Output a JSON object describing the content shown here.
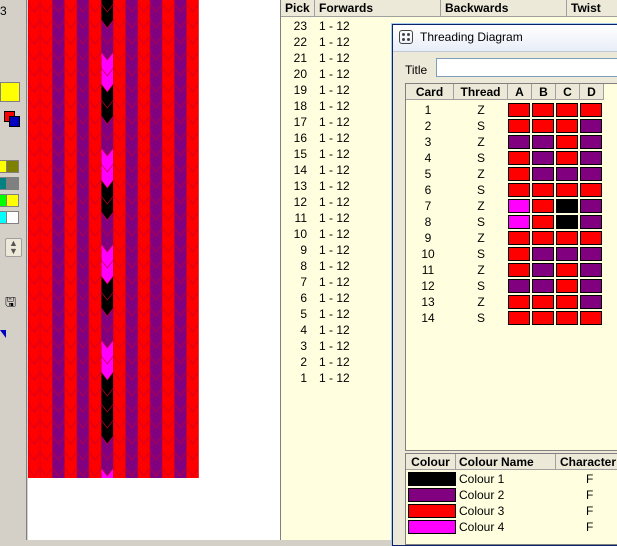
{
  "left_panel": {
    "top_text": "3",
    "swatches": [
      {
        "name": "swatch-yellow",
        "color": "#ffff00"
      },
      {
        "name": "swatch-olive",
        "color": "#808000"
      },
      {
        "name": "swatch-teal",
        "color": "#008080"
      },
      {
        "name": "swatch-gray",
        "color": "#808080"
      },
      {
        "name": "swatch-lime",
        "color": "#00ff00"
      },
      {
        "name": "swatch-yellow-2",
        "color": "#ffff00"
      },
      {
        "name": "swatch-cyan",
        "color": "#00ffff"
      },
      {
        "name": "swatch-white",
        "color": "#ffffff"
      }
    ]
  },
  "pattern": {
    "columns": [
      "#ff0000",
      "#ff0000",
      "#800080",
      "#ff0000",
      "#800080",
      "#ff0000",
      "#800080",
      "#ff0000",
      "#800080",
      "#ff0000",
      "#800080",
      "#ff0000",
      "#800080",
      "#ff0000"
    ],
    "center_rows": [
      "#000000",
      "#800080",
      "#ff00ff",
      "#000000",
      "#800080",
      "#ff00ff",
      "#000000",
      "#800080",
      "#ff00ff",
      "#000000",
      "#800080",
      "#ff00ff",
      "#000000"
    ]
  },
  "pick_list": {
    "headers": {
      "pick": "Pick",
      "forwards": "Forwards",
      "backwards": "Backwards",
      "twist": "Twist"
    },
    "rows": [
      {
        "pick": "23",
        "fw": "1 - 12"
      },
      {
        "pick": "22",
        "fw": "1 - 12"
      },
      {
        "pick": "21",
        "fw": "1 - 12"
      },
      {
        "pick": "20",
        "fw": "1 - 12"
      },
      {
        "pick": "19",
        "fw": "1 - 12"
      },
      {
        "pick": "18",
        "fw": "1 - 12"
      },
      {
        "pick": "17",
        "fw": "1 - 12"
      },
      {
        "pick": "16",
        "fw": "1 - 12"
      },
      {
        "pick": "15",
        "fw": "1 - 12"
      },
      {
        "pick": "14",
        "fw": "1 - 12"
      },
      {
        "pick": "13",
        "fw": "1 - 12"
      },
      {
        "pick": "12",
        "fw": "1 - 12"
      },
      {
        "pick": "11",
        "fw": "1 - 12"
      },
      {
        "pick": "10",
        "fw": "1 - 12"
      },
      {
        "pick": "9",
        "fw": "1 - 12"
      },
      {
        "pick": "8",
        "fw": "1 - 12"
      },
      {
        "pick": "7",
        "fw": "1 - 12"
      },
      {
        "pick": "6",
        "fw": "1 - 12"
      },
      {
        "pick": "5",
        "fw": "1 - 12"
      },
      {
        "pick": "4",
        "fw": "1 - 12"
      },
      {
        "pick": "3",
        "fw": "1 - 12"
      },
      {
        "pick": "2",
        "fw": "1 - 12"
      },
      {
        "pick": "1",
        "fw": "1 - 12"
      }
    ]
  },
  "dialog": {
    "title": "Threading Diagram",
    "title_label": "Title",
    "title_value": "",
    "card_headers": {
      "card": "Card",
      "thread": "Thread",
      "a": "A",
      "b": "B",
      "c": "C",
      "d": "D"
    },
    "cards": [
      {
        "card": "1",
        "thread": "Z",
        "holes": [
          "#ff0000",
          "#ff0000",
          "#ff0000",
          "#ff0000"
        ]
      },
      {
        "card": "2",
        "thread": "S",
        "holes": [
          "#ff0000",
          "#ff0000",
          "#ff0000",
          "#800080"
        ]
      },
      {
        "card": "3",
        "thread": "Z",
        "holes": [
          "#800080",
          "#800080",
          "#ff0000",
          "#800080"
        ]
      },
      {
        "card": "4",
        "thread": "S",
        "holes": [
          "#ff0000",
          "#800080",
          "#ff0000",
          "#800080"
        ]
      },
      {
        "card": "5",
        "thread": "Z",
        "holes": [
          "#ff0000",
          "#800080",
          "#800080",
          "#800080"
        ]
      },
      {
        "card": "6",
        "thread": "S",
        "holes": [
          "#ff0000",
          "#ff0000",
          "#ff0000",
          "#ff0000"
        ]
      },
      {
        "card": "7",
        "thread": "Z",
        "holes": [
          "#ff00ff",
          "#ff0000",
          "#000000",
          "#800080"
        ]
      },
      {
        "card": "8",
        "thread": "S",
        "holes": [
          "#ff00ff",
          "#ff0000",
          "#000000",
          "#800080"
        ]
      },
      {
        "card": "9",
        "thread": "Z",
        "holes": [
          "#ff0000",
          "#ff0000",
          "#ff0000",
          "#ff0000"
        ]
      },
      {
        "card": "10",
        "thread": "S",
        "holes": [
          "#ff0000",
          "#800080",
          "#800080",
          "#800080"
        ]
      },
      {
        "card": "11",
        "thread": "Z",
        "holes": [
          "#ff0000",
          "#800080",
          "#ff0000",
          "#800080"
        ]
      },
      {
        "card": "12",
        "thread": "S",
        "holes": [
          "#800080",
          "#800080",
          "#ff0000",
          "#800080"
        ]
      },
      {
        "card": "13",
        "thread": "Z",
        "holes": [
          "#ff0000",
          "#ff0000",
          "#ff0000",
          "#800080"
        ]
      },
      {
        "card": "14",
        "thread": "S",
        "holes": [
          "#ff0000",
          "#ff0000",
          "#ff0000",
          "#ff0000"
        ]
      }
    ],
    "colour_headers": {
      "colour": "Colour",
      "name": "Colour Name",
      "character": "Character"
    },
    "colours": [
      {
        "color": "#000000",
        "name": "Colour 1",
        "character": "F"
      },
      {
        "color": "#800080",
        "name": "Colour 2",
        "character": "F"
      },
      {
        "color": "#ff0000",
        "name": "Colour 3",
        "character": "F"
      },
      {
        "color": "#ff00ff",
        "name": "Colour 4",
        "character": "F"
      }
    ]
  }
}
